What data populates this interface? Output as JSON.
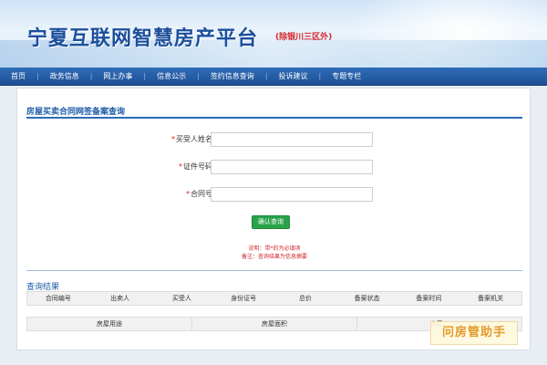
{
  "header": {
    "title": "宁夏互联网智慧房产平台",
    "subtitle": "(除银川三区外)"
  },
  "nav": {
    "items": [
      {
        "label": "首页"
      },
      {
        "label": "政务信息"
      },
      {
        "label": "网上办事"
      },
      {
        "label": "信息公示"
      },
      {
        "label": "签约信息查询"
      },
      {
        "label": "投诉建议"
      },
      {
        "label": "专题专栏"
      }
    ]
  },
  "main": {
    "section_title": "房屋买卖合同网签备案查询",
    "form": {
      "buyer_name_label": "买受人姓名",
      "id_number_label": "证件号码",
      "contract_no_label": "合同号",
      "required_mark": "*",
      "buyer_name_value": "",
      "id_number_value": "",
      "contract_no_value": ""
    },
    "submit_label": "确认查询",
    "notes": {
      "line1": "说明：带*的为必填项",
      "line2": "备注：查询结果为信息摘要"
    },
    "results": {
      "title": "查询结果",
      "columns": [
        "合同编号",
        "出卖人",
        "买受人",
        "身份证号",
        "总价",
        "备案状态",
        "备案时间",
        "备案机关"
      ],
      "sub_columns": [
        "房屋用途",
        "房屋面积",
        "房屋..."
      ]
    }
  },
  "watermark": {
    "text": "问房管助手"
  },
  "colors": {
    "brand_blue": "#1c4f9c",
    "nav_blue": "#1d4f93",
    "accent_red": "#d6262d",
    "button_green": "#2aa24a",
    "watermark_orange": "#e39a2a"
  }
}
